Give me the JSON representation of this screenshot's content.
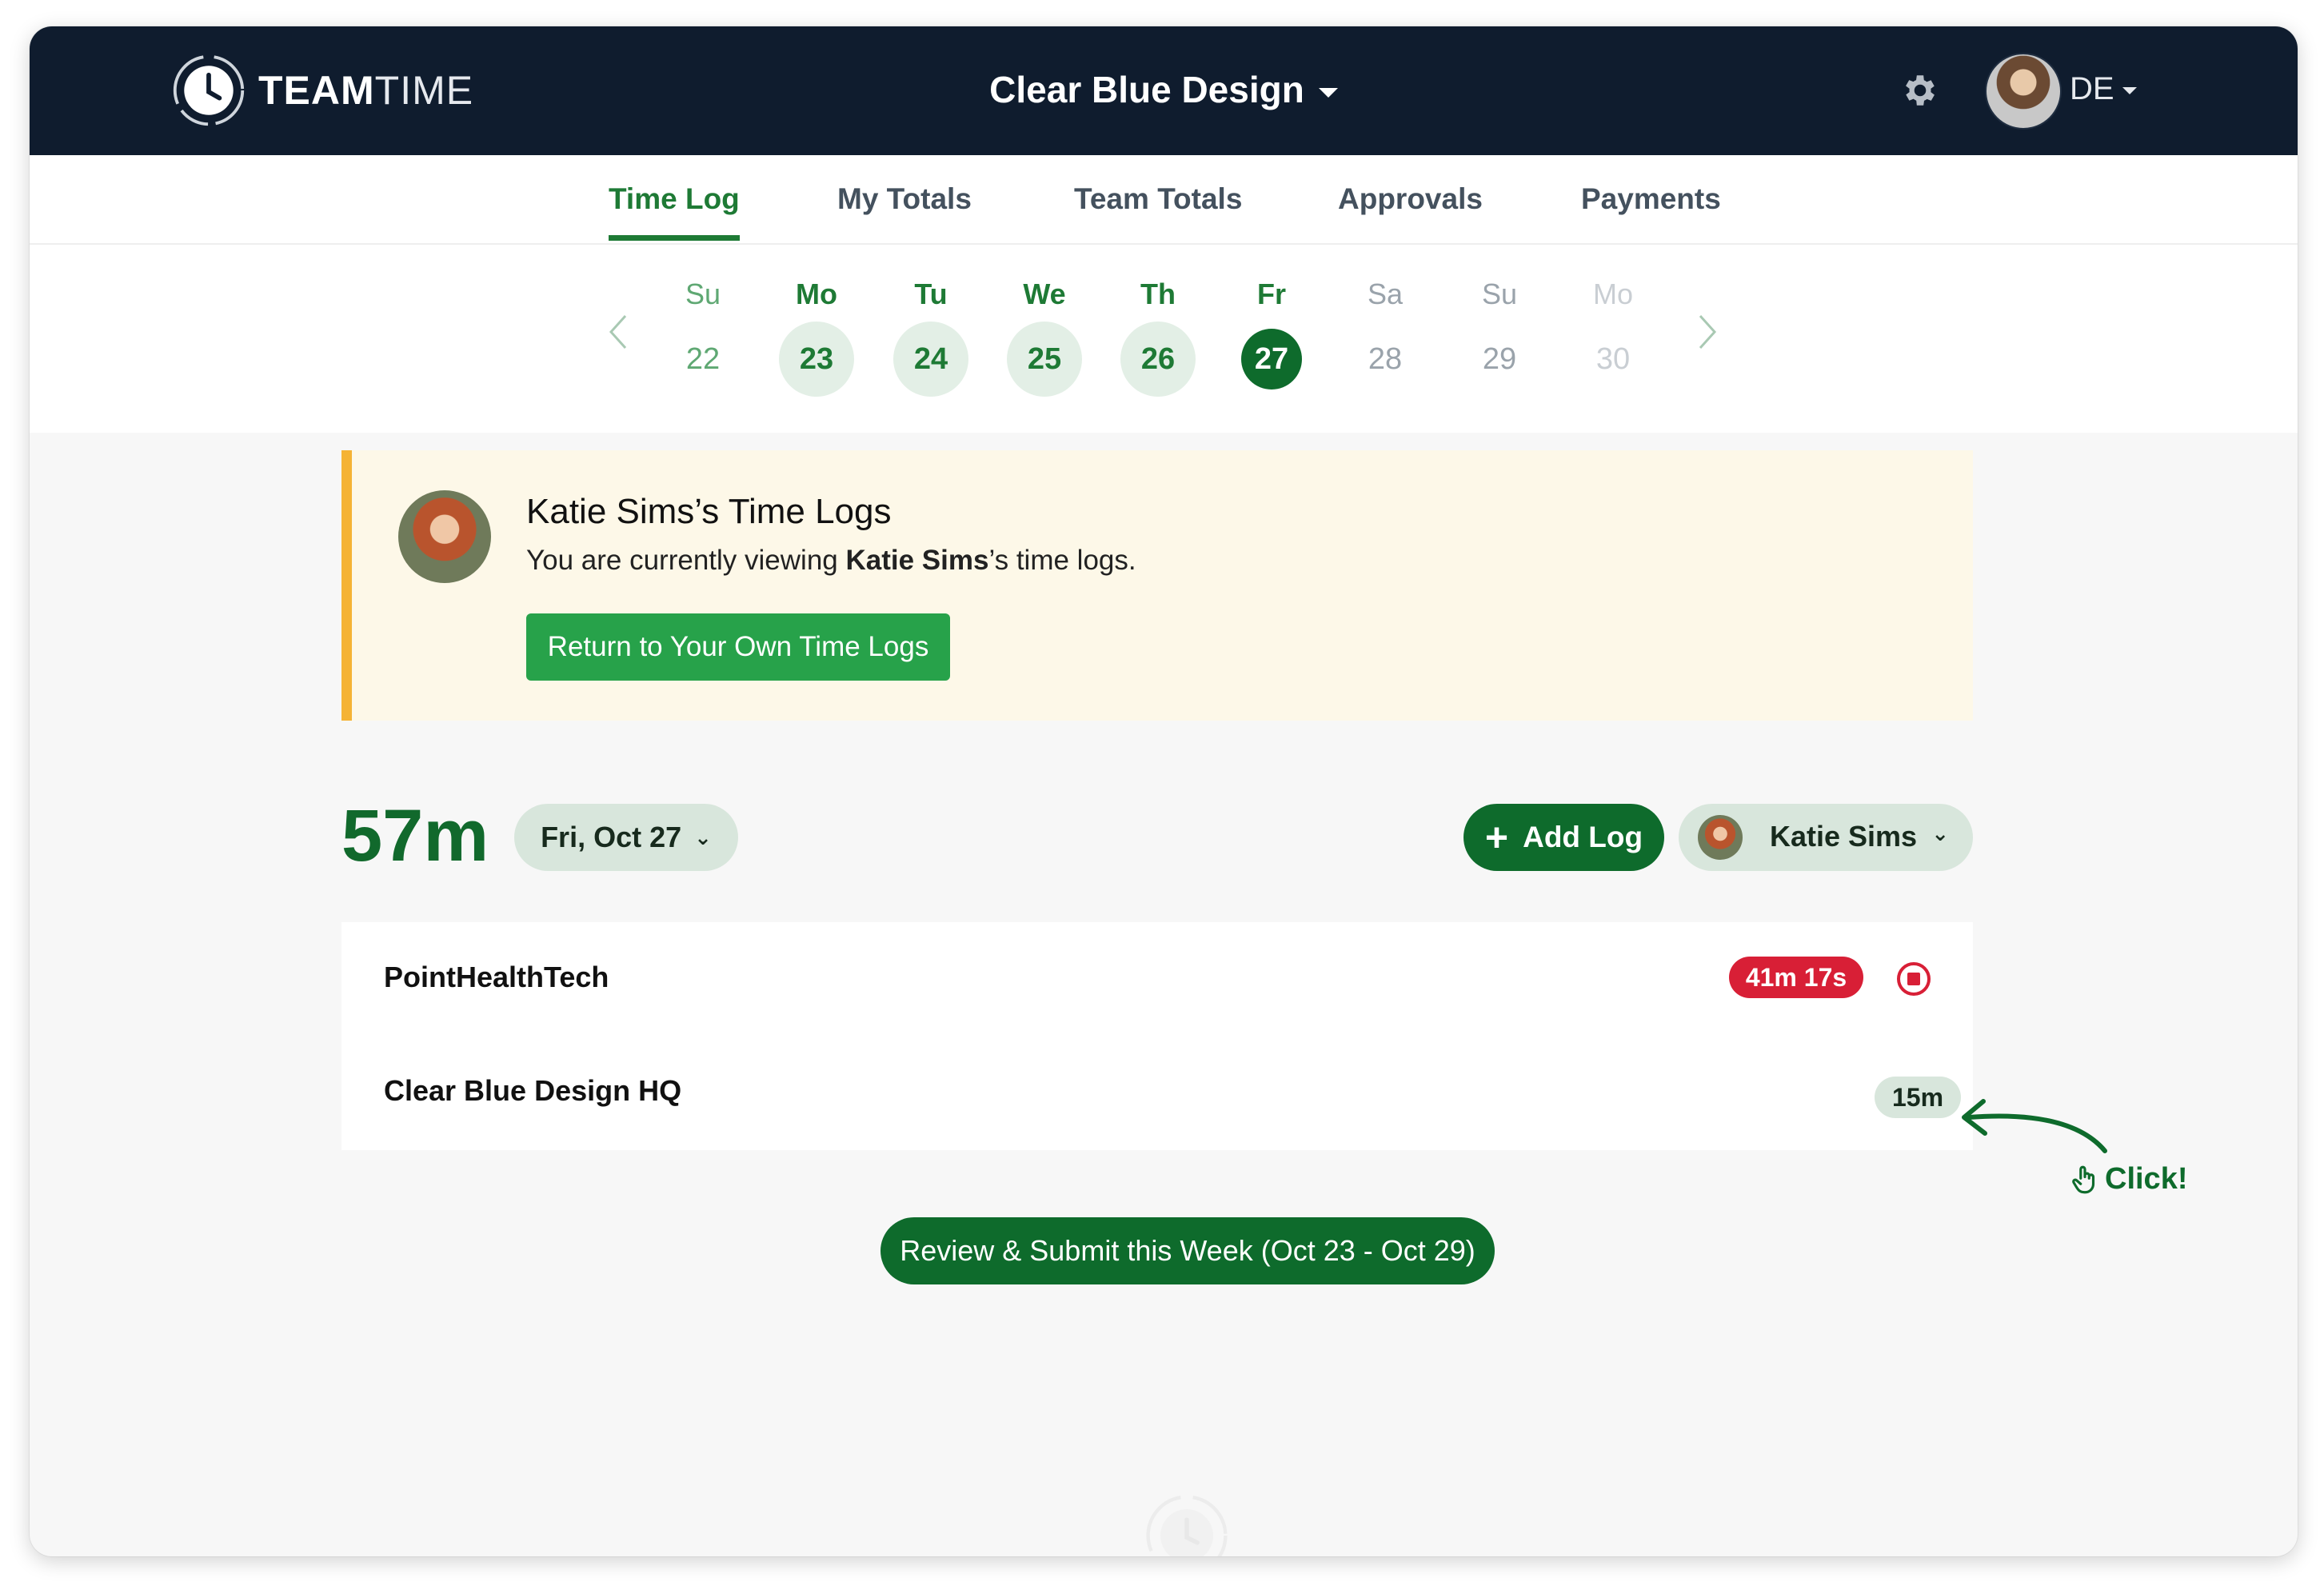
{
  "brand": {
    "bold": "TEAM",
    "light": "TIME"
  },
  "org": {
    "name": "Clear Blue Design"
  },
  "user": {
    "initials": "DE"
  },
  "nav": {
    "tabs": [
      {
        "label": "Time Log",
        "active": true
      },
      {
        "label": "My Totals"
      },
      {
        "label": "Team Totals"
      },
      {
        "label": "Approvals"
      },
      {
        "label": "Payments"
      }
    ]
  },
  "calendar": {
    "days": [
      {
        "name": "Su",
        "num": "22",
        "state": "past"
      },
      {
        "name": "Mo",
        "num": "23",
        "state": "week"
      },
      {
        "name": "Tu",
        "num": "24",
        "state": "week"
      },
      {
        "name": "We",
        "num": "25",
        "state": "week"
      },
      {
        "name": "Th",
        "num": "26",
        "state": "week"
      },
      {
        "name": "Fr",
        "num": "27",
        "state": "today"
      },
      {
        "name": "Sa",
        "num": "28",
        "state": "future"
      },
      {
        "name": "Su",
        "num": "29",
        "state": "future"
      },
      {
        "name": "Mo",
        "num": "30",
        "state": "far"
      }
    ]
  },
  "banner": {
    "title": "Katie Sims’s Time Logs",
    "sub_prefix": "You are currently viewing ",
    "sub_name": "Katie Sims",
    "sub_suffix": "’s time logs.",
    "button": "Return to Your Own Time Logs"
  },
  "summary": {
    "total": "57m",
    "date": "Fri, Oct 27",
    "add_log": "Add Log",
    "selected_user": "Katie Sims"
  },
  "logs": [
    {
      "name": "PointHealthTech",
      "duration": "41m 17s",
      "running": true
    },
    {
      "name": "Clear Blue Design HQ",
      "duration": "15m",
      "running": false
    }
  ],
  "annotation": {
    "text": "Click!"
  },
  "submit": {
    "label": "Review & Submit this Week (Oct 23 - Oct 29)"
  },
  "colors": {
    "navy": "#0f1c2e",
    "green": "#0e6b2c",
    "accent_green": "#27a24a",
    "warning": "#f5b335",
    "running_red": "#d81f36"
  }
}
